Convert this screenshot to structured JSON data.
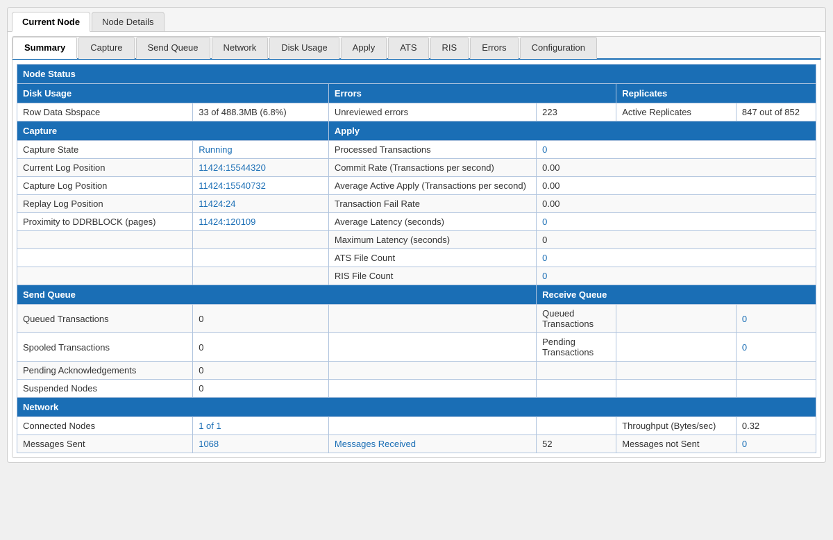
{
  "topTabs": [
    {
      "label": "Current Node",
      "active": true
    },
    {
      "label": "Node Details",
      "active": false
    }
  ],
  "subTabs": [
    {
      "label": "Summary",
      "active": true
    },
    {
      "label": "Capture",
      "active": false
    },
    {
      "label": "Send Queue",
      "active": false
    },
    {
      "label": "Network",
      "active": false
    },
    {
      "label": "Disk Usage",
      "active": false
    },
    {
      "label": "Apply",
      "active": false
    },
    {
      "label": "ATS",
      "active": false
    },
    {
      "label": "RIS",
      "active": false
    },
    {
      "label": "Errors",
      "active": false
    },
    {
      "label": "Configuration",
      "active": false
    }
  ],
  "sections": {
    "nodeStatus": "Node Status",
    "diskUsageHeader": "Disk Usage",
    "errorsHeader": "Errors",
    "replicatesHeader": "Replicates",
    "diskUsageLabel": "Row Data Sbspace",
    "diskUsageValue": "33 of 488.3MB (6.8%)",
    "unreviewedLabel": "Unreviewed errors",
    "unreviewedValue": "223",
    "activeReplicatesLabel": "Active Replicates",
    "activeReplicatesValue": "847 out of 852",
    "captureHeader": "Capture",
    "applyHeader": "Apply",
    "captureStateLabel": "Capture State",
    "captureStateValue": "Running",
    "processedTxLabel": "Processed Transactions",
    "processedTxValue": "0",
    "currentLogLabel": "Current Log Position",
    "currentLogValue": "11424:15544320",
    "commitRateLabel": "Commit Rate (Transactions per second)",
    "commitRateValue": "0.00",
    "captureLogLabel": "Capture Log Position",
    "captureLogValue": "11424:15540732",
    "avgActiveApplyLabel": "Average Active Apply (Transactions per second)",
    "avgActiveApplyValue": "0.00",
    "replayLogLabel": "Replay Log Position",
    "replayLogValue": "11424:24",
    "txFailRateLabel": "Transaction Fail Rate",
    "txFailRateValue": "0.00",
    "proximityLabel": "Proximity to DDRBLOCK (pages)",
    "proximityValue": "11424:120109",
    "avgLatencyLabel": "Average Latency (seconds)",
    "avgLatencyValue": "0",
    "maxLatencyLabel": "Maximum Latency (seconds)",
    "maxLatencyValue": "0",
    "atsFileCountLabel": "ATS File Count",
    "atsFileCountValue": "0",
    "risFileCountLabel": "RIS File Count",
    "risFileCountValue": "0",
    "sendQueueHeader": "Send Queue",
    "receiveQueueHeader": "Receive Queue",
    "sqQueuedTxLabel": "Queued Transactions",
    "sqQueuedTxValue": "0",
    "rqQueuedTxLabel": "Queued Transactions",
    "rqQueuedTxValue": "0",
    "sqSpooledTxLabel": "Spooled Transactions",
    "sqSpooledTxValue": "0",
    "rqPendingTxLabel": "Pending Transactions",
    "rqPendingTxValue": "0",
    "sqPendingAckLabel": "Pending Acknowledgements",
    "sqPendingAckValue": "0",
    "sqSuspendedNodesLabel": "Suspended Nodes",
    "sqSuspendedNodesValue": "0",
    "networkHeader": "Network",
    "connectedNodesLabel": "Connected Nodes",
    "connectedNodesValue": "1 of 1",
    "throughputLabel": "Throughput (Bytes/sec)",
    "throughputValue": "0.32",
    "messagesSentLabel": "Messages Sent",
    "messagesSentValue": "1068",
    "messagesReceivedLabel": "Messages Received",
    "messagesReceivedValue": "52",
    "messagesNotSentLabel": "Messages not Sent",
    "messagesNotSentValue": "0"
  }
}
